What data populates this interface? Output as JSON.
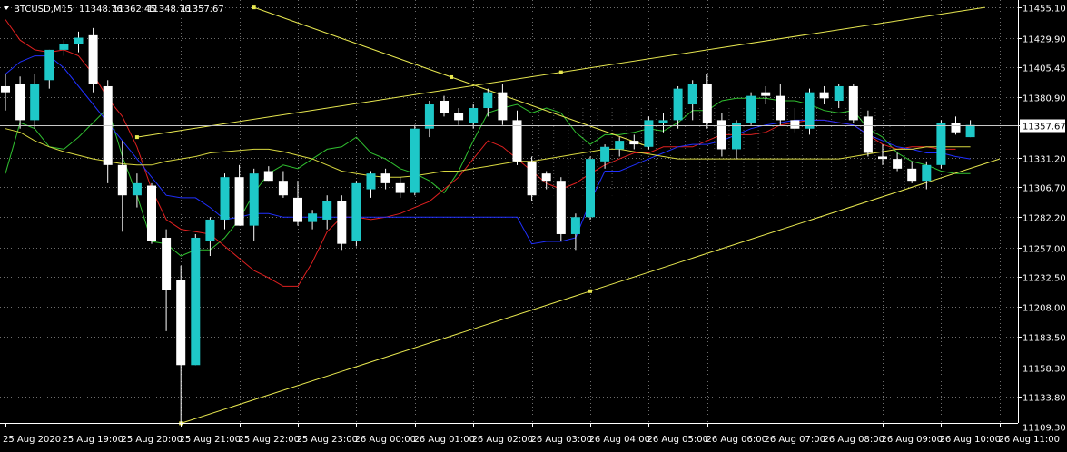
{
  "header": {
    "symbol": "BTCUSD,M15",
    "open": "11348.76",
    "high": "11362.45",
    "low": "11348.76",
    "close": "11357.67"
  },
  "colors": {
    "background": "#000000",
    "grid": "#c8c8c8",
    "bull_candle": "#1ec8c8",
    "bear_candle": "#ffffff",
    "trendline": "#e8e850",
    "ma_blue": "#2030ff",
    "ma_red": "#e02020",
    "ma_green": "#30c030",
    "ma_yellow": "#d8d840",
    "ma_magenta": "#c020c0",
    "ichimoku_dots": "#ffffff",
    "price_label_bg": "#ffffff"
  },
  "chart_data": {
    "type": "candlestick",
    "symbol": "BTCUSD",
    "timeframe": "M15",
    "current_price": "11357.67",
    "ylim": [
      11109.3,
      11455.1
    ],
    "y_ticks": [
      "11455.10",
      "11429.90",
      "11405.45",
      "11380.90",
      "11357.67",
      "11331.20",
      "11306.70",
      "11282.20",
      "11257.00",
      "11232.50",
      "11208.00",
      "11183.50",
      "11158.30",
      "11133.80",
      "11109.30"
    ],
    "x_ticks": [
      "25 Aug 2020",
      "25 Aug 19:00",
      "25 Aug 20:00",
      "25 Aug 21:00",
      "25 Aug 22:00",
      "25 Aug 23:00",
      "26 Aug 00:00",
      "26 Aug 01:00",
      "26 Aug 02:00",
      "26 Aug 03:00",
      "26 Aug 04:00",
      "26 Aug 05:00",
      "26 Aug 06:00",
      "26 Aug 07:00",
      "26 Aug 08:00",
      "26 Aug 09:00",
      "26 Aug 10:00",
      "26 Aug 11:00"
    ],
    "candles": [
      {
        "o": 11390,
        "h": 11400,
        "l": 11370,
        "c": 11385
      },
      {
        "o": 11392,
        "h": 11398,
        "l": 11355,
        "c": 11362
      },
      {
        "o": 11362,
        "h": 11400,
        "l": 11355,
        "c": 11392
      },
      {
        "o": 11395,
        "h": 11420,
        "l": 11388,
        "c": 11420
      },
      {
        "o": 11420,
        "h": 11428,
        "l": 11415,
        "c": 11425
      },
      {
        "o": 11425,
        "h": 11435,
        "l": 11418,
        "c": 11430
      },
      {
        "o": 11432,
        "h": 11438,
        "l": 11385,
        "c": 11392
      },
      {
        "o": 11390,
        "h": 11395,
        "l": 11310,
        "c": 11325
      },
      {
        "o": 11325,
        "h": 11345,
        "l": 11270,
        "c": 11300
      },
      {
        "o": 11300,
        "h": 11318,
        "l": 11290,
        "c": 11310
      },
      {
        "o": 11308,
        "h": 11310,
        "l": 11260,
        "c": 11262
      },
      {
        "o": 11265,
        "h": 11272,
        "l": 11188,
        "c": 11222
      },
      {
        "o": 11230,
        "h": 11242,
        "l": 11112,
        "c": 11160
      },
      {
        "o": 11160,
        "h": 11268,
        "l": 11160,
        "c": 11265
      },
      {
        "o": 11262,
        "h": 11282,
        "l": 11250,
        "c": 11280
      },
      {
        "o": 11280,
        "h": 11318,
        "l": 11272,
        "c": 11315
      },
      {
        "o": 11315,
        "h": 11325,
        "l": 11275,
        "c": 11275
      },
      {
        "o": 11275,
        "h": 11322,
        "l": 11262,
        "c": 11318
      },
      {
        "o": 11320,
        "h": 11324,
        "l": 11312,
        "c": 11312
      },
      {
        "o": 11312,
        "h": 11320,
        "l": 11298,
        "c": 11300
      },
      {
        "o": 11298,
        "h": 11312,
        "l": 11275,
        "c": 11278
      },
      {
        "o": 11278,
        "h": 11288,
        "l": 11272,
        "c": 11285
      },
      {
        "o": 11280,
        "h": 11300,
        "l": 11272,
        "c": 11295
      },
      {
        "o": 11295,
        "h": 11300,
        "l": 11255,
        "c": 11260
      },
      {
        "o": 11262,
        "h": 11312,
        "l": 11258,
        "c": 11310
      },
      {
        "o": 11305,
        "h": 11320,
        "l": 11298,
        "c": 11318
      },
      {
        "o": 11318,
        "h": 11322,
        "l": 11305,
        "c": 11310
      },
      {
        "o": 11310,
        "h": 11315,
        "l": 11298,
        "c": 11302
      },
      {
        "o": 11302,
        "h": 11358,
        "l": 11300,
        "c": 11355
      },
      {
        "o": 11355,
        "h": 11378,
        "l": 11348,
        "c": 11375
      },
      {
        "o": 11378,
        "h": 11382,
        "l": 11365,
        "c": 11368
      },
      {
        "o": 11368,
        "h": 11372,
        "l": 11358,
        "c": 11362
      },
      {
        "o": 11360,
        "h": 11375,
        "l": 11355,
        "c": 11372
      },
      {
        "o": 11372,
        "h": 11388,
        "l": 11365,
        "c": 11385
      },
      {
        "o": 11385,
        "h": 11392,
        "l": 11358,
        "c": 11362
      },
      {
        "o": 11362,
        "h": 11370,
        "l": 11325,
        "c": 11328
      },
      {
        "o": 11328,
        "h": 11332,
        "l": 11295,
        "c": 11300
      },
      {
        "o": 11318,
        "h": 11320,
        "l": 11305,
        "c": 11312
      },
      {
        "o": 11312,
        "h": 11315,
        "l": 11262,
        "c": 11268
      },
      {
        "o": 11268,
        "h": 11285,
        "l": 11255,
        "c": 11282
      },
      {
        "o": 11282,
        "h": 11332,
        "l": 11280,
        "c": 11330
      },
      {
        "o": 11328,
        "h": 11342,
        "l": 11322,
        "c": 11340
      },
      {
        "o": 11338,
        "h": 11348,
        "l": 11332,
        "c": 11345
      },
      {
        "o": 11345,
        "h": 11350,
        "l": 11338,
        "c": 11342
      },
      {
        "o": 11340,
        "h": 11365,
        "l": 11338,
        "c": 11362
      },
      {
        "o": 11360,
        "h": 11368,
        "l": 11352,
        "c": 11362
      },
      {
        "o": 11362,
        "h": 11390,
        "l": 11355,
        "c": 11388
      },
      {
        "o": 11375,
        "h": 11395,
        "l": 11362,
        "c": 11392
      },
      {
        "o": 11392,
        "h": 11400,
        "l": 11355,
        "c": 11360
      },
      {
        "o": 11362,
        "h": 11368,
        "l": 11332,
        "c": 11338
      },
      {
        "o": 11338,
        "h": 11362,
        "l": 11330,
        "c": 11360
      },
      {
        "o": 11360,
        "h": 11385,
        "l": 11358,
        "c": 11382
      },
      {
        "o": 11385,
        "h": 11390,
        "l": 11375,
        "c": 11382
      },
      {
        "o": 11382,
        "h": 11392,
        "l": 11358,
        "c": 11362
      },
      {
        "o": 11362,
        "h": 11372,
        "l": 11352,
        "c": 11355
      },
      {
        "o": 11355,
        "h": 11388,
        "l": 11350,
        "c": 11385
      },
      {
        "o": 11385,
        "h": 11390,
        "l": 11375,
        "c": 11380
      },
      {
        "o": 11378,
        "h": 11392,
        "l": 11372,
        "c": 11390
      },
      {
        "o": 11390,
        "h": 11392,
        "l": 11360,
        "c": 11362
      },
      {
        "o": 11365,
        "h": 11370,
        "l": 11332,
        "c": 11335
      },
      {
        "o": 11332,
        "h": 11342,
        "l": 11325,
        "c": 11330
      },
      {
        "o": 11330,
        "h": 11335,
        "l": 11320,
        "c": 11322
      },
      {
        "o": 11322,
        "h": 11328,
        "l": 11310,
        "c": 11312
      },
      {
        "o": 11312,
        "h": 11328,
        "l": 11305,
        "c": 11325
      },
      {
        "o": 11325,
        "h": 11362,
        "l": 11322,
        "c": 11360
      },
      {
        "o": 11360,
        "h": 11365,
        "l": 11350,
        "c": 11352
      },
      {
        "o": 11348,
        "h": 11362,
        "l": 11348,
        "c": 11358
      }
    ],
    "indicators": [
      {
        "color": "ma_green",
        "values": [
          11318,
          11360,
          11355,
          11340,
          11338,
          11348,
          11360,
          11372,
          11332,
          11300,
          11262,
          11260,
          11250,
          11255,
          11255,
          11265,
          11280,
          11302,
          11318,
          11325,
          11322,
          11330,
          11338,
          11340,
          11348,
          11335,
          11330,
          11322,
          11318,
          11312,
          11302,
          11320,
          11345,
          11368,
          11372,
          11375,
          11368,
          11372,
          11368,
          11352,
          11342,
          11350,
          11350,
          11352,
          11355,
          11353,
          11360,
          11370,
          11370,
          11378,
          11380,
          11380,
          11380,
          11378,
          11378,
          11375,
          11370,
          11368,
          11370,
          11355,
          11348,
          11335,
          11328,
          11325,
          11320,
          11318,
          11318
        ]
      },
      {
        "color": "ma_red",
        "values": [
          11445,
          11428,
          11420,
          11418,
          11420,
          11415,
          11400,
          11380,
          11365,
          11340,
          11305,
          11280,
          11272,
          11270,
          11268,
          11258,
          11248,
          11238,
          11232,
          11225,
          11225,
          11245,
          11270,
          11282,
          11282,
          11280,
          11282,
          11285,
          11290,
          11295,
          11305,
          11315,
          11330,
          11345,
          11340,
          11330,
          11320,
          11310,
          11305,
          11310,
          11318,
          11325,
          11330,
          11335,
          11335,
          11340,
          11340,
          11340,
          11345,
          11350,
          11350,
          11350,
          11352,
          11358,
          11360,
          11362,
          11362,
          11360,
          11358,
          11350,
          11342,
          11338,
          11340,
          11340,
          11338,
          11338
        ]
      },
      {
        "color": "ma_blue",
        "values": [
          11400,
          11410,
          11415,
          11415,
          11405,
          11390,
          11375,
          11360,
          11345,
          11330,
          11315,
          11300,
          11298,
          11298,
          11290,
          11280,
          11282,
          11285,
          11285,
          11282,
          11282,
          11282,
          11282,
          11282,
          11282,
          11282,
          11282,
          11282,
          11282,
          11282,
          11282,
          11282,
          11282,
          11282,
          11282,
          11282,
          11260,
          11262,
          11262,
          11265,
          11295,
          11320,
          11320,
          11325,
          11330,
          11335,
          11340,
          11342,
          11342,
          11345,
          11350,
          11355,
          11358,
          11360,
          11362,
          11362,
          11362,
          11360,
          11358,
          11350,
          11345,
          11340,
          11338,
          11335,
          11335,
          11332,
          11330
        ]
      },
      {
        "color": "ma_yellow",
        "values": [
          11355,
          11352,
          11345,
          11340,
          11336,
          11333,
          11330,
          11328,
          11326,
          11325,
          11325,
          11328,
          11330,
          11332,
          11335,
          11336,
          11337,
          11338,
          11338,
          11336,
          11333,
          11330,
          11325,
          11320,
          11318,
          11316,
          11315,
          11315,
          11316,
          11318,
          11320,
          11320,
          11322,
          11324,
          11326,
          11328,
          11328,
          11330,
          11332,
          11334,
          11336,
          11338,
          11338,
          11336,
          11334,
          11332,
          11330,
          11330,
          11330,
          11330,
          11330,
          11330,
          11330,
          11330,
          11330,
          11330,
          11330,
          11330,
          11332,
          11334,
          11336,
          11338,
          11338,
          11340,
          11340,
          11340,
          11340
        ]
      }
    ],
    "trendlines": [
      {
        "x1": 9,
        "y1": 11348,
        "x2": 67,
        "y2": 11455
      },
      {
        "x1": 12,
        "y1": 11112,
        "x2": 68,
        "y2": 11330
      },
      {
        "x1": 17,
        "y1": 11455,
        "x2": 44,
        "y2": 11340
      }
    ]
  }
}
